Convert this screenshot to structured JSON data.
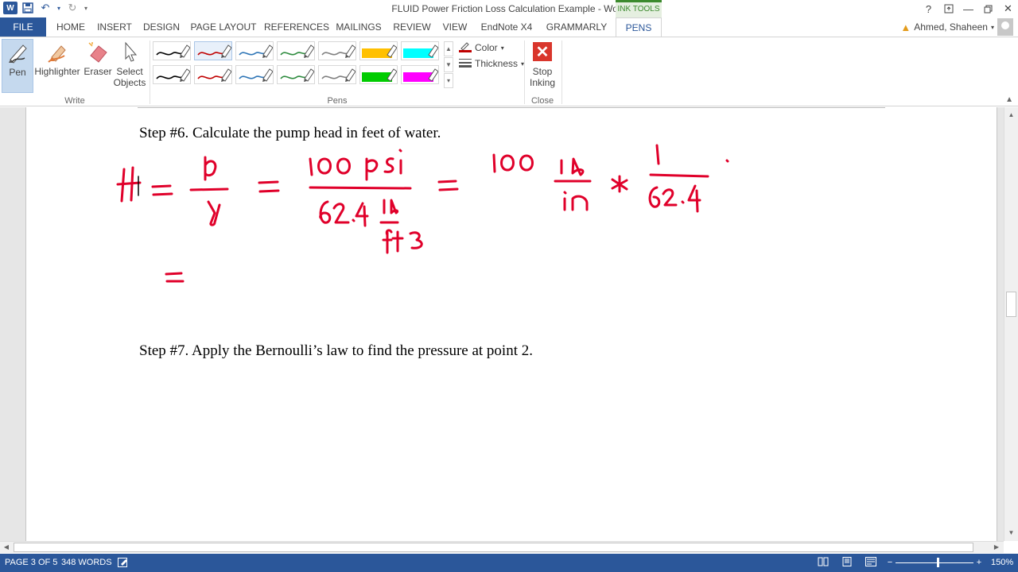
{
  "window": {
    "title": "FLUID Power Friction Loss Calculation Example - Word",
    "contextual_tab_group": "INK TOOLS"
  },
  "tabs": [
    "FILE",
    "HOME",
    "INSERT",
    "DESIGN",
    "PAGE LAYOUT",
    "REFERENCES",
    "MAILINGS",
    "REVIEW",
    "VIEW",
    "EndNote X4",
    "GRAMMARLY",
    "PENS"
  ],
  "user": {
    "name": "Ahmed, Shaheen"
  },
  "ribbon": {
    "write_group": {
      "label": "Write",
      "pen": "Pen",
      "highlighter": "Highlighter",
      "eraser": "Eraser",
      "select_objects_line1": "Select",
      "select_objects_line2": "Objects"
    },
    "pens_group": {
      "label": "Pens",
      "color_label": "Color",
      "thickness_label": "Thickness",
      "pen_colors_row1": [
        "#000000",
        "#c00000",
        "#2e75b6",
        "#2e8b3e",
        "#7f7f7f",
        "#ffc000",
        "#00ffff"
      ],
      "pen_colors_row2": [
        "#000000",
        "#c00000",
        "#2e75b6",
        "#2e8b3e",
        "#7f7f7f",
        "#00cc00",
        "#ff00ff"
      ],
      "selected_pen": "red pen"
    },
    "close_group": {
      "label": "Close",
      "stop_inking_line1": "Stop",
      "stop_inking_line2": "Inking"
    }
  },
  "document": {
    "step6": "Step #6. Calculate the pump head in feet of water.",
    "step7": "Step #7. Apply the Bernoulli’s law to find the pressure at point 2.",
    "ink_color": "#e0002a"
  },
  "statusbar": {
    "page": "PAGE 3 OF 5",
    "words": "348 WORDS",
    "zoom": "150%"
  },
  "colors": {
    "word_blue": "#2b579a",
    "ink_tools_green": "#3c8a2e",
    "stop_red": "#d9362c"
  }
}
